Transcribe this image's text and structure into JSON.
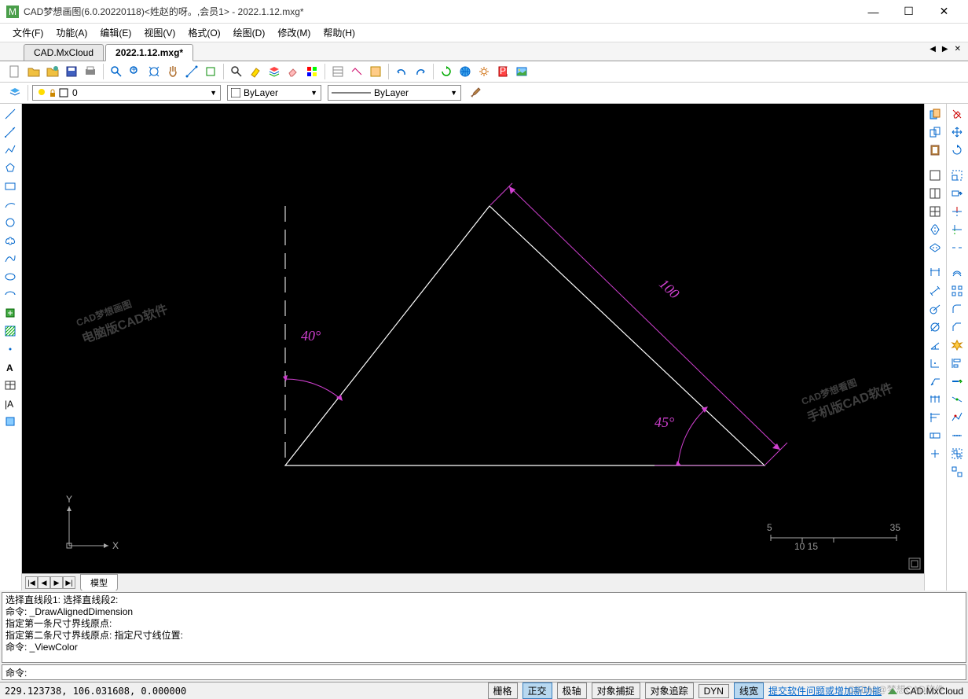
{
  "title": "CAD梦想画图(6.0.20220118)<姓赵的呀。,会员1> - 2022.1.12.mxg*",
  "menu": [
    "文件(F)",
    "功能(A)",
    "编辑(E)",
    "视图(V)",
    "格式(O)",
    "绘图(D)",
    "修改(M)",
    "帮助(H)"
  ],
  "tabs": [
    {
      "label": "CAD.MxCloud",
      "active": false
    },
    {
      "label": "2022.1.12.mxg*",
      "active": true
    }
  ],
  "layer_combo": {
    "value": "0"
  },
  "color_combo": {
    "value": "ByLayer"
  },
  "linetype_combo": {
    "value": "ByLayer"
  },
  "bottom_tab": "模型",
  "cmdlog": [
    "选择直线段1: 选择直线段2:",
    "命令: _DrawAlignedDimension",
    "",
    "指定第一条尺寸界线原点:",
    "指定第二条尺寸界线原点: 指定尺寸线位置:",
    "命令: _ViewColor"
  ],
  "cmd_prompt": "命令:",
  "cmd_input": "",
  "coords": "229.123738, 106.031608,  0.000000",
  "status_buttons": [
    {
      "label": "栅格",
      "active": false
    },
    {
      "label": "正交",
      "active": true
    },
    {
      "label": "极轴",
      "active": false
    },
    {
      "label": "对象捕捉",
      "active": false
    },
    {
      "label": "对象追踪",
      "active": false
    },
    {
      "label": "DYN",
      "active": false
    },
    {
      "label": "线宽",
      "active": true
    }
  ],
  "status_link": "提交软件问题或增加新功能",
  "brand": "CAD.MxCloud",
  "drawing": {
    "angle1": "40°",
    "angle2": "45°",
    "length": "100"
  },
  "scale": {
    "left": "5",
    "right": "35",
    "bottom": "10        15"
  },
  "watermarks": {
    "left_top": "CAD梦想画图",
    "left_sub": "电脑版CAD软件",
    "right_top": "CAD梦想看图",
    "right_sub": "手机版CAD软件",
    "csdn": "CSDN @梦想CAD软件"
  }
}
